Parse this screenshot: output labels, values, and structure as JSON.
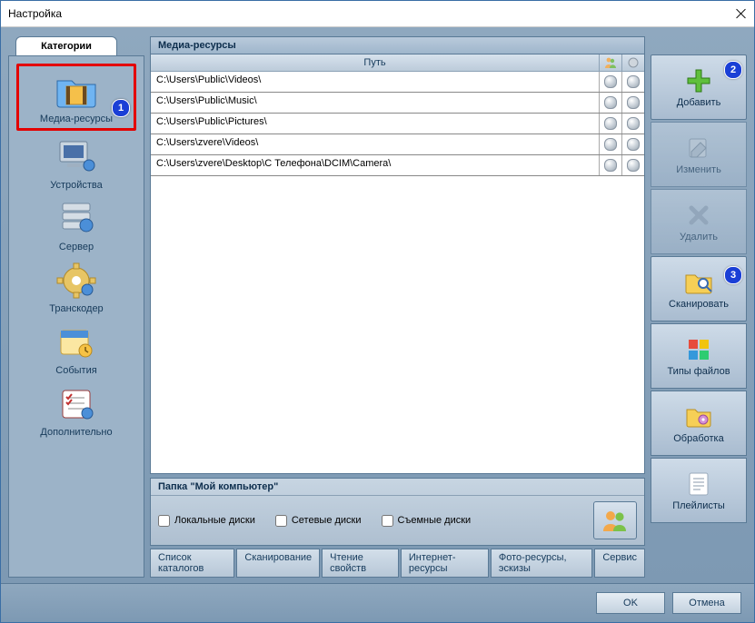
{
  "window": {
    "title": "Настройка"
  },
  "categories": {
    "tab_label": "Категории",
    "items": [
      {
        "label": "Медиа-ресурсы"
      },
      {
        "label": "Устройства"
      },
      {
        "label": "Сервер"
      },
      {
        "label": "Транскодер"
      },
      {
        "label": "События"
      },
      {
        "label": "Дополнительно"
      }
    ]
  },
  "media": {
    "header": "Медиа-ресурсы",
    "path_col": "Путь",
    "rows": [
      "C:\\Users\\Public\\Videos\\",
      "C:\\Users\\Public\\Music\\",
      "C:\\Users\\Public\\Pictures\\",
      "C:\\Users\\zvere\\Videos\\",
      "C:\\Users\\zvere\\Desktop\\С Телефона\\DCIM\\Camera\\"
    ]
  },
  "props": {
    "title": "Папка \"Мой компьютер\"",
    "local": "Локальные диски",
    "network": "Сетевые диски",
    "removable": "Съемные диски"
  },
  "tabs": {
    "catalogs": "Список каталогов",
    "scan": "Сканирование",
    "readprops": "Чтение свойств",
    "internet": "Интернет-ресурсы",
    "photo": "Фото-ресурсы, эскизы",
    "service": "Сервис"
  },
  "right": {
    "add": "Добавить",
    "edit": "Изменить",
    "delete": "Удалить",
    "scan": "Сканировать",
    "filetypes": "Типы файлов",
    "processing": "Обработка",
    "playlists": "Плейлисты"
  },
  "footer": {
    "ok": "OK",
    "cancel": "Отмена"
  },
  "badges": {
    "one": "1",
    "two": "2",
    "three": "3"
  }
}
